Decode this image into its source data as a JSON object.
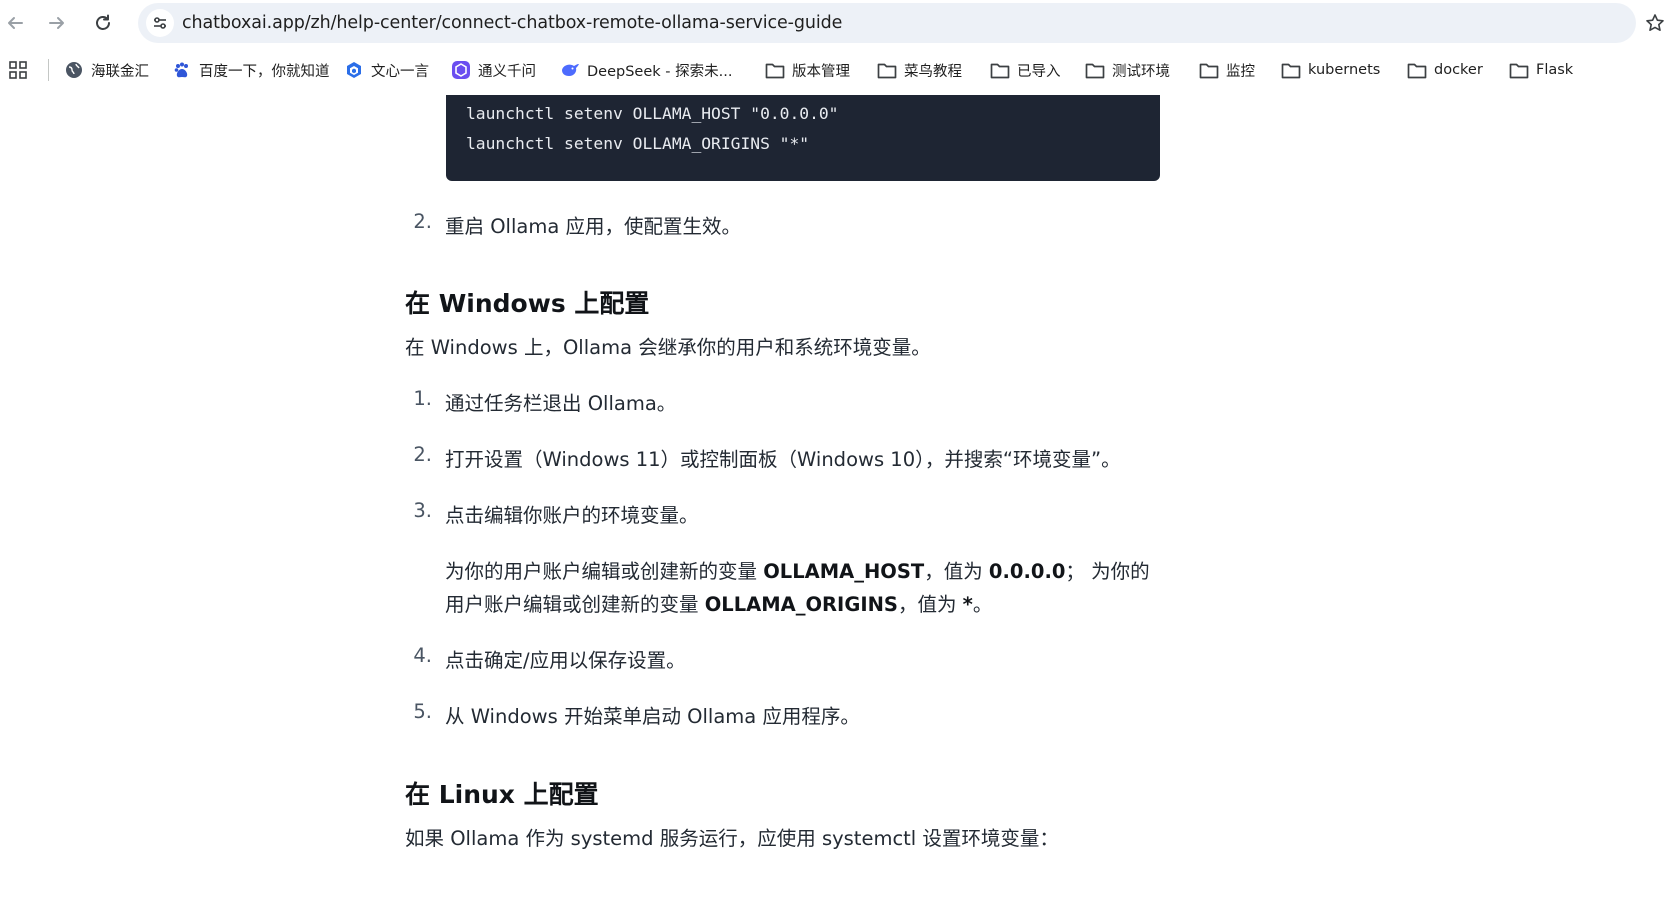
{
  "browser": {
    "url": "chatboxai.app/zh/help-center/connect-chatbox-remote-ollama-service-guide"
  },
  "bookmarks": [
    {
      "label": "海联金汇",
      "icon": "globe-icon"
    },
    {
      "label": "百度一下，你就知道",
      "icon": "baidu-paw-icon"
    },
    {
      "label": "文心一言",
      "icon": "wenxin-icon"
    },
    {
      "label": "通义千问",
      "icon": "tongyi-icon"
    },
    {
      "label": "DeepSeek - 探索未...",
      "icon": "deepseek-icon"
    },
    {
      "label": "版本管理",
      "icon": "folder-icon"
    },
    {
      "label": "菜鸟教程",
      "icon": "folder-icon"
    },
    {
      "label": "已导入",
      "icon": "folder-icon"
    },
    {
      "label": "测试环境",
      "icon": "folder-icon"
    },
    {
      "label": "监控",
      "icon": "folder-icon"
    },
    {
      "label": "kubernets",
      "icon": "folder-icon"
    },
    {
      "label": "docker",
      "icon": "folder-icon"
    },
    {
      "label": "Flask",
      "icon": "folder-icon"
    }
  ],
  "article": {
    "code_lines": [
      "launchctl setenv OLLAMA_HOST \"0.0.0.0\"",
      "launchctl setenv OLLAMA_ORIGINS \"*\""
    ],
    "mac_step2": {
      "num": "2.",
      "text": "重启 Ollama 应用，使配置生效。"
    },
    "windows_heading": "在 Windows 上配置",
    "windows_intro": "在 Windows 上，Ollama 会继承你的用户和系统环境变量。",
    "windows_steps": [
      {
        "num": "1.",
        "text": "通过任务栏退出 Ollama。"
      },
      {
        "num": "2.",
        "text": "打开设置（Windows 11）或控制面板（Windows 10），并搜索“环境变量”。"
      },
      {
        "num": "3.",
        "text": "点击编辑你账户的环境变量。"
      },
      {
        "num": "4.",
        "text": "点击确定/应用以保存设置。"
      },
      {
        "num": "5.",
        "text": "从 Windows 开始菜单启动 Ollama 应用程序。"
      }
    ],
    "step3_detail": {
      "p1": "为你的用户账户编辑或创建新的变量 ",
      "host_var": "OLLAMA_HOST",
      "p2": "，值为 ",
      "host_val": "0.0.0.0",
      "p3": "； 为你的",
      "p4": "用户账户编辑或创建新的变量 ",
      "origins_var": "OLLAMA_ORIGINS",
      "p5": "，值为 ",
      "origins_val": "*",
      "p6": "。"
    },
    "linux_heading": "在 Linux 上配置",
    "linux_intro": "如果 Ollama 作为 systemd 服务运行，应使用 systemctl 设置环境变量："
  }
}
